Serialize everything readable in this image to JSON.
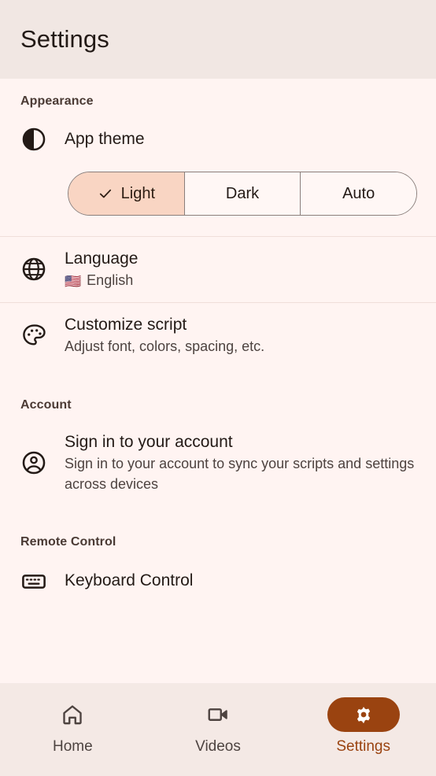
{
  "header": {
    "title": "Settings"
  },
  "sections": [
    {
      "id": "appearance",
      "label": "Appearance",
      "rows": [
        {
          "id": "app-theme",
          "icon": "contrast-icon",
          "primary": "App theme",
          "secondary": ""
        },
        {
          "id": "language",
          "icon": "globe-icon",
          "primary": "Language",
          "flag": "🇺🇸",
          "secondary": "English"
        },
        {
          "id": "customize-script",
          "icon": "palette-icon",
          "primary": "Customize script",
          "secondary": "Adjust font, colors, spacing, etc."
        }
      ]
    },
    {
      "id": "account",
      "label": "Account",
      "rows": [
        {
          "id": "sign-in",
          "icon": "account-circle-icon",
          "primary": "Sign in to your account",
          "secondary": "Sign in to your account to sync your scripts and settings across devices"
        }
      ]
    },
    {
      "id": "remote-control",
      "label": "Remote Control",
      "rows": [
        {
          "id": "keyboard-control",
          "icon": "keyboard-icon",
          "primary": "Keyboard Control",
          "secondary": ""
        }
      ]
    }
  ],
  "theme_segments": {
    "options": [
      "Light",
      "Dark",
      "Auto"
    ],
    "selected": "Light",
    "selected_color": "#F9D5C3",
    "outline_color": "#8A7F7C"
  },
  "bottom_nav": {
    "active": "Settings",
    "active_color": "#9A4310",
    "items": [
      {
        "id": "home",
        "label": "Home",
        "icon": "home-icon"
      },
      {
        "id": "videos",
        "label": "Videos",
        "icon": "video-camera-icon"
      },
      {
        "id": "settings",
        "label": "Settings",
        "icon": "gear-icon"
      }
    ]
  }
}
